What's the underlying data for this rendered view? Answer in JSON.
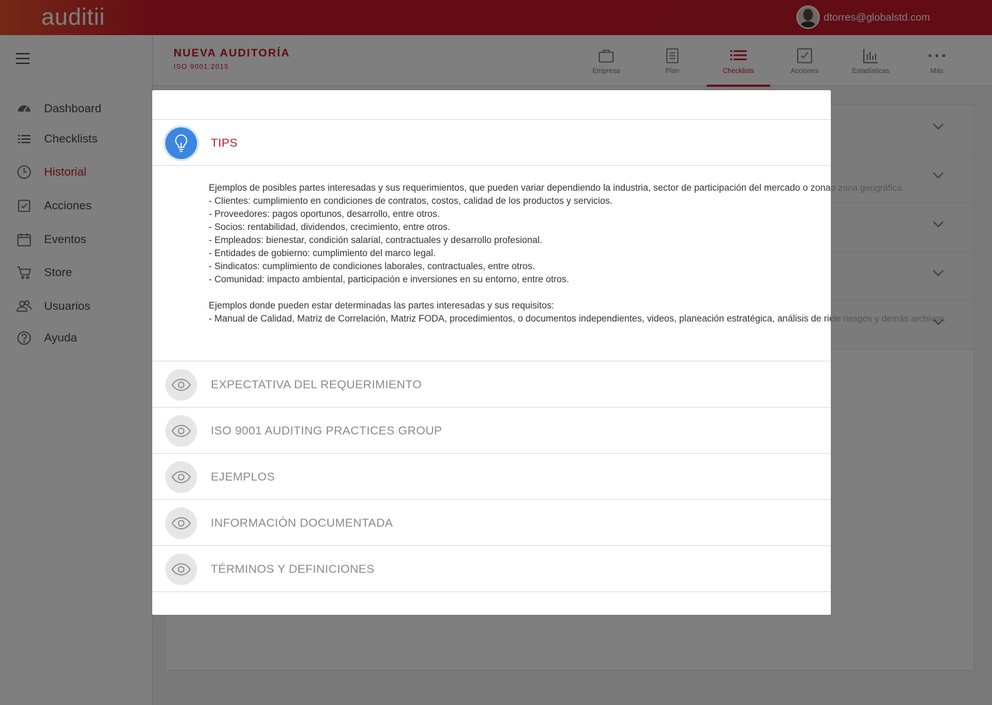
{
  "app": {
    "logo": "auditii",
    "user_email": "dtorres@globalstd.com"
  },
  "sidebar": {
    "items": [
      {
        "label": "Dashboard",
        "icon": "dashboard-icon"
      },
      {
        "label": "Checklists",
        "icon": "list-icon"
      },
      {
        "label": "Historial",
        "icon": "clock-icon",
        "active": true
      },
      {
        "label": "Acciones",
        "icon": "checkbox-icon"
      },
      {
        "label": "Eventos",
        "icon": "calendar-icon"
      },
      {
        "label": "Store",
        "icon": "cart-icon"
      },
      {
        "label": "Usuarios",
        "icon": "users-icon"
      },
      {
        "label": "Ayuda",
        "icon": "help-icon"
      }
    ]
  },
  "header": {
    "title": "NUEVA AUDITORÍA",
    "subtitle": "ISO 9001:2015",
    "tabs": [
      {
        "label": "Empresa",
        "icon": "briefcase-icon"
      },
      {
        "label": "Plan",
        "icon": "document-icon"
      },
      {
        "label": "Checklists",
        "icon": "list-icon",
        "active": true
      },
      {
        "label": "Acciones",
        "icon": "checkbox-icon"
      },
      {
        "label": "Estadísticas",
        "icon": "bar-chart-icon"
      },
      {
        "label": "Más",
        "icon": "more-icon"
      }
    ]
  },
  "background": {
    "partial_text": "o zona geográfica.",
    "partial_text_2": "de riesgos y demás archivos."
  },
  "modal": {
    "tips": {
      "title": "TIPS",
      "lines": [
        "Ejemplos de posibles partes interesadas y sus requerimientos, que pueden variar dependiendo la industria, sector de participación del mercado o zona geográfica.",
        "- Clientes: cumplimiento en condiciones de contratos, costos, calidad de los productos y servicios.",
        "- Proveedores: pagos oportunos, desarrollo, entre otros.",
        "- Socios: rentabilidad, dividendos, crecimiento, entre otros.",
        "- Empleados: bienestar, condición salarial, contractuales y desarrollo profesional.",
        "- Entidades de gobierno: cumplimiento del marco legal.",
        "- Sindicatos: cumplimiento de condiciones laborales, contractuales, entre otros.",
        "- Comunidad: impacto ambiental, participación e inversiones en su entorno, entre otros.",
        "",
        "Ejemplos donde pueden estar determinadas las partes interesadas y sus requisitos:",
        "- Manual de Calidad, Matriz de Correlación, Matriz FODA, procedimientos, o documentos independientes, videos, planeación estratégica, análisis de riesgos y demás archivos."
      ]
    },
    "sections": [
      {
        "title": "EXPECTATIVA DEL REQUERIMIENTO"
      },
      {
        "title": "ISO 9001 AUDITING PRACTICES GROUP"
      },
      {
        "title": "EJEMPLOS"
      },
      {
        "title": "INFORMACIÓN DOCUMENTADA"
      },
      {
        "title": "TÉRMINOS Y DEFINICIONES"
      }
    ]
  },
  "colors": {
    "brand": "#c4182a",
    "tips_icon": "#3b86e0"
  }
}
